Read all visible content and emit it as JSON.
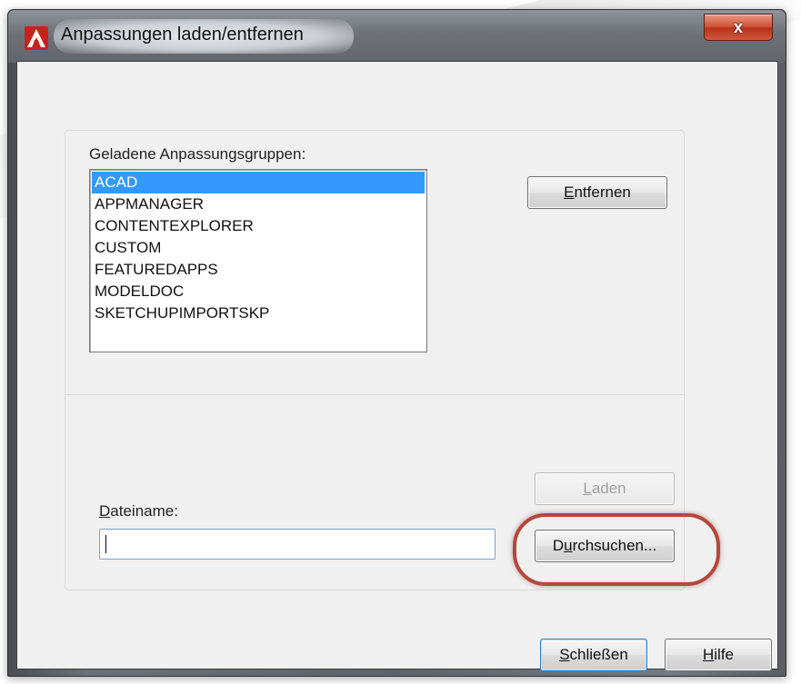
{
  "window": {
    "title": "Anpassungen laden/entfernen",
    "close_label": "x"
  },
  "groups_section": {
    "label": "Geladene Anpassungsgruppen:",
    "items": [
      {
        "label": "ACAD",
        "selected": true
      },
      {
        "label": "APPMANAGER",
        "selected": false
      },
      {
        "label": "CONTENTEXPLORER",
        "selected": false
      },
      {
        "label": "CUSTOM",
        "selected": false
      },
      {
        "label": "FEATUREDAPPS",
        "selected": false
      },
      {
        "label": "MODELDOC",
        "selected": false
      },
      {
        "label": "SKETCHUPIMPORTSKP",
        "selected": false
      }
    ],
    "remove_button": {
      "mnemonic": "E",
      "rest": "ntfernen"
    }
  },
  "file_section": {
    "label_mnemonic": "D",
    "label_rest": "ateiname:",
    "value": "",
    "load_button": {
      "mnemonic": "L",
      "rest": "aden",
      "enabled": false
    },
    "browse_button": {
      "prefix": "D",
      "mnemonic": "u",
      "rest": "rchsuchen..."
    }
  },
  "footer": {
    "close_button": {
      "mnemonic": "S",
      "rest": "chließen"
    },
    "help_button": {
      "mnemonic": "H",
      "rest": "ilfe"
    }
  },
  "colors": {
    "selection": "#3399ff",
    "highlight_ring": "#b5473b"
  }
}
